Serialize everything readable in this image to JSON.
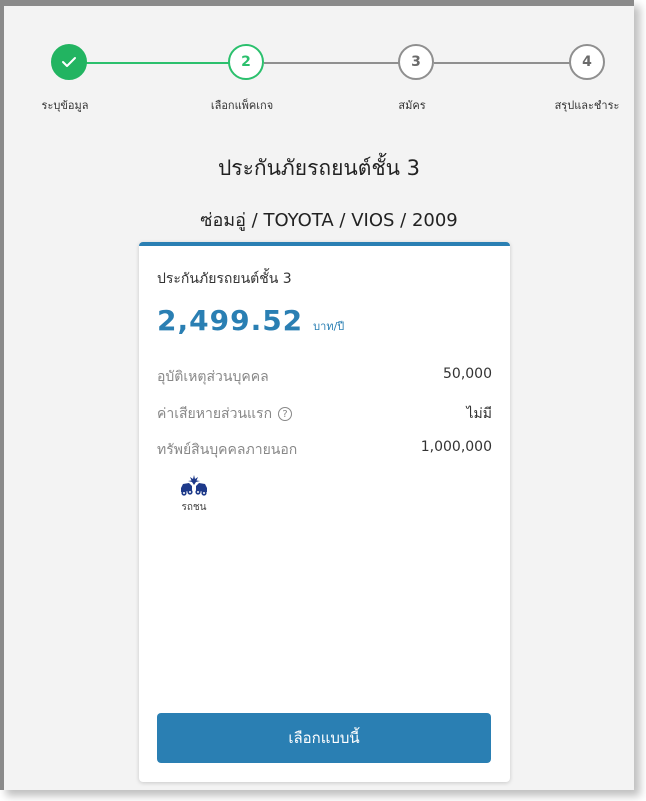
{
  "stepper": {
    "steps": [
      {
        "number": "",
        "label": "ระบุข้อมูล",
        "state": "done"
      },
      {
        "number": "2",
        "label": "เลือกแพ็คเกจ",
        "state": "active"
      },
      {
        "number": "3",
        "label": "สมัคร",
        "state": "todo"
      },
      {
        "number": "4",
        "label": "สรุปและชำระ",
        "state": "todo"
      }
    ]
  },
  "header": {
    "title": "ประกันภัยรถยนต์ชั้น 3",
    "subtitle": "ซ่อมอู่ / TOYOTA / VIOS / 2009"
  },
  "plan": {
    "name": "ประกันภัยรถยนต์ชั้น 3",
    "price": "2,499.52",
    "price_unit": "บาท/ปี",
    "coverages": [
      {
        "label": "อุบัติเหตุส่วนบุคคล",
        "value": "50,000",
        "has_help": false
      },
      {
        "label": "ค่าเสียหายส่วนแรก",
        "value": "ไม่มี",
        "has_help": true
      },
      {
        "label": "ทรัพย์สินบุคคลภายนอก",
        "value": "1,000,000",
        "has_help": false
      }
    ],
    "feature": {
      "icon": "car-crash-icon",
      "label": "รถชน"
    },
    "select_label": "เลือกแบบนี้"
  },
  "colors": {
    "success": "#22b461",
    "primary": "#2a7fb3",
    "inactive": "#8f8f8f"
  }
}
